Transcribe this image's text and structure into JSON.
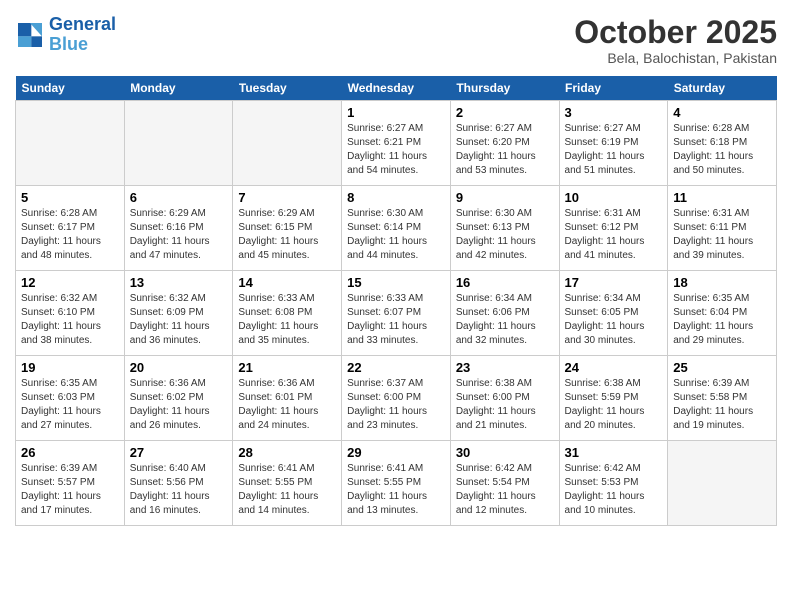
{
  "logo": {
    "line1": "General",
    "line2": "Blue"
  },
  "title": "October 2025",
  "subtitle": "Bela, Balochistan, Pakistan",
  "weekdays": [
    "Sunday",
    "Monday",
    "Tuesday",
    "Wednesday",
    "Thursday",
    "Friday",
    "Saturday"
  ],
  "weeks": [
    [
      {
        "day": "",
        "info": ""
      },
      {
        "day": "",
        "info": ""
      },
      {
        "day": "",
        "info": ""
      },
      {
        "day": "1",
        "info": "Sunrise: 6:27 AM\nSunset: 6:21 PM\nDaylight: 11 hours\nand 54 minutes."
      },
      {
        "day": "2",
        "info": "Sunrise: 6:27 AM\nSunset: 6:20 PM\nDaylight: 11 hours\nand 53 minutes."
      },
      {
        "day": "3",
        "info": "Sunrise: 6:27 AM\nSunset: 6:19 PM\nDaylight: 11 hours\nand 51 minutes."
      },
      {
        "day": "4",
        "info": "Sunrise: 6:28 AM\nSunset: 6:18 PM\nDaylight: 11 hours\nand 50 minutes."
      }
    ],
    [
      {
        "day": "5",
        "info": "Sunrise: 6:28 AM\nSunset: 6:17 PM\nDaylight: 11 hours\nand 48 minutes."
      },
      {
        "day": "6",
        "info": "Sunrise: 6:29 AM\nSunset: 6:16 PM\nDaylight: 11 hours\nand 47 minutes."
      },
      {
        "day": "7",
        "info": "Sunrise: 6:29 AM\nSunset: 6:15 PM\nDaylight: 11 hours\nand 45 minutes."
      },
      {
        "day": "8",
        "info": "Sunrise: 6:30 AM\nSunset: 6:14 PM\nDaylight: 11 hours\nand 44 minutes."
      },
      {
        "day": "9",
        "info": "Sunrise: 6:30 AM\nSunset: 6:13 PM\nDaylight: 11 hours\nand 42 minutes."
      },
      {
        "day": "10",
        "info": "Sunrise: 6:31 AM\nSunset: 6:12 PM\nDaylight: 11 hours\nand 41 minutes."
      },
      {
        "day": "11",
        "info": "Sunrise: 6:31 AM\nSunset: 6:11 PM\nDaylight: 11 hours\nand 39 minutes."
      }
    ],
    [
      {
        "day": "12",
        "info": "Sunrise: 6:32 AM\nSunset: 6:10 PM\nDaylight: 11 hours\nand 38 minutes."
      },
      {
        "day": "13",
        "info": "Sunrise: 6:32 AM\nSunset: 6:09 PM\nDaylight: 11 hours\nand 36 minutes."
      },
      {
        "day": "14",
        "info": "Sunrise: 6:33 AM\nSunset: 6:08 PM\nDaylight: 11 hours\nand 35 minutes."
      },
      {
        "day": "15",
        "info": "Sunrise: 6:33 AM\nSunset: 6:07 PM\nDaylight: 11 hours\nand 33 minutes."
      },
      {
        "day": "16",
        "info": "Sunrise: 6:34 AM\nSunset: 6:06 PM\nDaylight: 11 hours\nand 32 minutes."
      },
      {
        "day": "17",
        "info": "Sunrise: 6:34 AM\nSunset: 6:05 PM\nDaylight: 11 hours\nand 30 minutes."
      },
      {
        "day": "18",
        "info": "Sunrise: 6:35 AM\nSunset: 6:04 PM\nDaylight: 11 hours\nand 29 minutes."
      }
    ],
    [
      {
        "day": "19",
        "info": "Sunrise: 6:35 AM\nSunset: 6:03 PM\nDaylight: 11 hours\nand 27 minutes."
      },
      {
        "day": "20",
        "info": "Sunrise: 6:36 AM\nSunset: 6:02 PM\nDaylight: 11 hours\nand 26 minutes."
      },
      {
        "day": "21",
        "info": "Sunrise: 6:36 AM\nSunset: 6:01 PM\nDaylight: 11 hours\nand 24 minutes."
      },
      {
        "day": "22",
        "info": "Sunrise: 6:37 AM\nSunset: 6:00 PM\nDaylight: 11 hours\nand 23 minutes."
      },
      {
        "day": "23",
        "info": "Sunrise: 6:38 AM\nSunset: 6:00 PM\nDaylight: 11 hours\nand 21 minutes."
      },
      {
        "day": "24",
        "info": "Sunrise: 6:38 AM\nSunset: 5:59 PM\nDaylight: 11 hours\nand 20 minutes."
      },
      {
        "day": "25",
        "info": "Sunrise: 6:39 AM\nSunset: 5:58 PM\nDaylight: 11 hours\nand 19 minutes."
      }
    ],
    [
      {
        "day": "26",
        "info": "Sunrise: 6:39 AM\nSunset: 5:57 PM\nDaylight: 11 hours\nand 17 minutes."
      },
      {
        "day": "27",
        "info": "Sunrise: 6:40 AM\nSunset: 5:56 PM\nDaylight: 11 hours\nand 16 minutes."
      },
      {
        "day": "28",
        "info": "Sunrise: 6:41 AM\nSunset: 5:55 PM\nDaylight: 11 hours\nand 14 minutes."
      },
      {
        "day": "29",
        "info": "Sunrise: 6:41 AM\nSunset: 5:55 PM\nDaylight: 11 hours\nand 13 minutes."
      },
      {
        "day": "30",
        "info": "Sunrise: 6:42 AM\nSunset: 5:54 PM\nDaylight: 11 hours\nand 12 minutes."
      },
      {
        "day": "31",
        "info": "Sunrise: 6:42 AM\nSunset: 5:53 PM\nDaylight: 11 hours\nand 10 minutes."
      },
      {
        "day": "",
        "info": ""
      }
    ]
  ]
}
